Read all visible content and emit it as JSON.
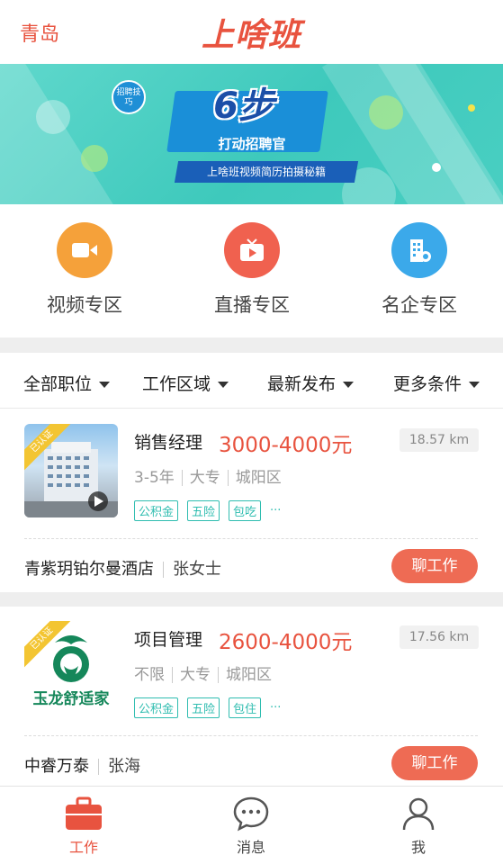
{
  "header": {
    "city": "青岛",
    "logo_text": "上啥班"
  },
  "banner": {
    "badge": "招聘技巧",
    "steps": "6步",
    "subtitle": "打动招聘官",
    "strip_text": "上啥班视频简历拍摄秘籍"
  },
  "quick_entries": [
    {
      "label": "视频专区",
      "icon": "video-icon",
      "color": "#f5a13a"
    },
    {
      "label": "直播专区",
      "icon": "tv-icon",
      "color": "#f0614f"
    },
    {
      "label": "名企专区",
      "icon": "building-icon",
      "color": "#3ba9ea"
    }
  ],
  "filters": [
    "全部职位",
    "工作区域",
    "最新发布",
    "更多条件"
  ],
  "jobs": [
    {
      "title": "销售经理",
      "salary": "3000-4000元",
      "distance": "18.57 km",
      "experience": "3-5年",
      "education": "大专",
      "district": "城阳区",
      "tags": [
        "公积金",
        "五险",
        "包吃"
      ],
      "more": "···",
      "certified": "已认证",
      "company": "青紫玥铂尔曼酒店",
      "contact": "张女士",
      "chat_label": "聊工作"
    },
    {
      "title": "项目管理",
      "salary": "2600-4000元",
      "distance": "17.56 km",
      "experience": "不限",
      "education": "大专",
      "district": "城阳区",
      "tags": [
        "公积金",
        "五险",
        "包住"
      ],
      "more": "···",
      "certified": "已认证",
      "logo_text": "玉龙舒适家",
      "company": "中睿万泰",
      "contact": "张海",
      "chat_label": "聊工作"
    }
  ],
  "tabbar": [
    {
      "label": "工作",
      "icon": "briefcase-icon",
      "active": true
    },
    {
      "label": "消息",
      "icon": "chat-bubble-icon",
      "active": false
    },
    {
      "label": "我",
      "icon": "user-icon",
      "active": false
    }
  ],
  "colors": {
    "accent": "#e8533f",
    "teal": "#2fbdb0"
  }
}
